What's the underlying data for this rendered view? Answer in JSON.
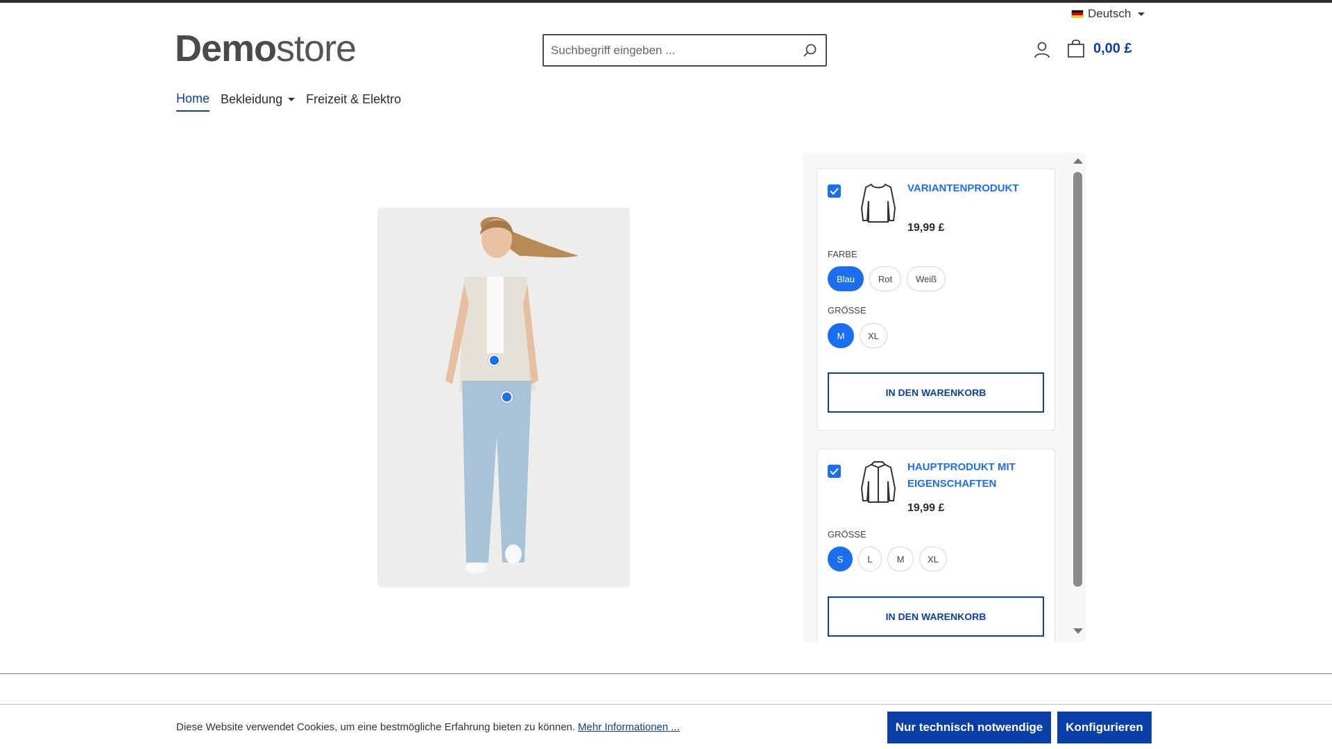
{
  "header": {
    "language": "Deutsch",
    "logo_bold": "Demo",
    "logo_light": "store",
    "search_placeholder": "Suchbegriff eingeben ...",
    "cart_total": "0,00 £"
  },
  "nav": {
    "items": [
      {
        "label": "Home",
        "active": true
      },
      {
        "label": "Bekleidung",
        "dropdown": true
      },
      {
        "label": "Freizeit & Elektro"
      }
    ]
  },
  "products": [
    {
      "title": "Variantenprodukt",
      "price": "19,99 £",
      "checked": true,
      "icon": "sweater-icon",
      "groups": [
        {
          "label": "Farbe",
          "options": [
            "Blau",
            "Rot",
            "Weiß"
          ],
          "selected": "Blau"
        },
        {
          "label": "Größe",
          "options": [
            "M",
            "XL"
          ],
          "selected": "M"
        }
      ],
      "button": "In den Warenkorb"
    },
    {
      "title_line1": "Hauptprodukt mit",
      "title_line2": "Eigenschaften",
      "price": "19,99 £",
      "checked": true,
      "icon": "jacket-icon",
      "groups": [
        {
          "label": "Größe",
          "options": [
            "S",
            "L",
            "M",
            "XL"
          ],
          "selected": "S"
        }
      ],
      "button": "In den Warenkorb"
    }
  ],
  "cookie": {
    "text": "Diese Website verwendet Cookies, um eine bestmögliche Erfahrung bieten zu können.",
    "link": "Mehr Informationen ...",
    "button_required": "Nur technisch notwendige",
    "button_configure": "Konfigurieren"
  },
  "colors": {
    "accent": "#1a6ff0",
    "brand_dark_blue": "#0a3fa8"
  }
}
